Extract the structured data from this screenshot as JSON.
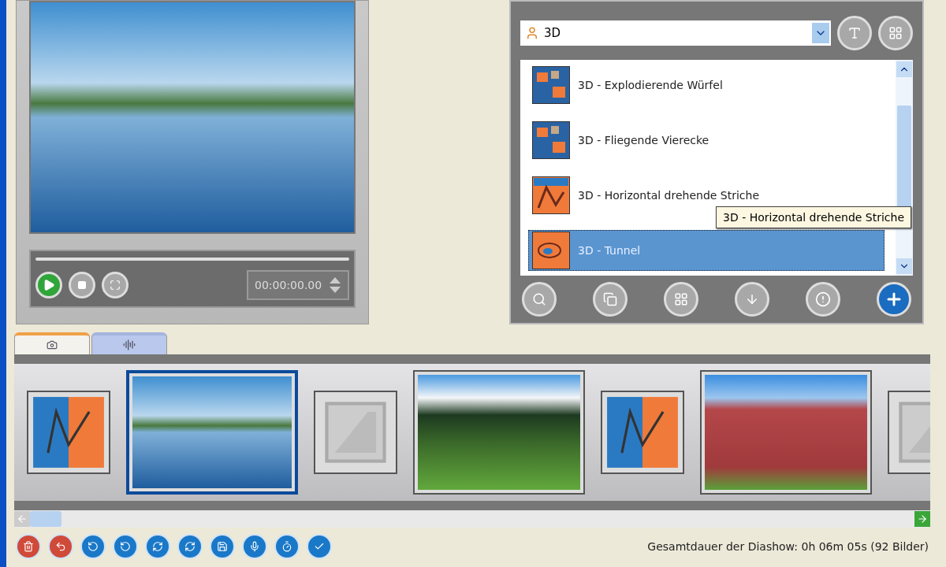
{
  "preview": {
    "time": "00:00:00.00"
  },
  "effects": {
    "category": "3D",
    "items": [
      {
        "label": "3D - Explodierende Würfel",
        "kind": "cubes",
        "selected": false
      },
      {
        "label": "3D - Fliegende Vierecke",
        "kind": "cubes",
        "selected": false
      },
      {
        "label": "3D - Horizontal drehende Striche",
        "kind": "stripes",
        "selected": false
      },
      {
        "label": "3D - Tunnel",
        "kind": "tunnel",
        "selected": true
      }
    ],
    "tooltip": "3D - Horizontal drehende Striche"
  },
  "tabs": [
    {
      "kind": "photos",
      "selected": true
    },
    {
      "kind": "audio",
      "selected": false
    }
  ],
  "filmstrip": [
    {
      "kind": "transition",
      "selected": false
    },
    {
      "kind": "photo",
      "selected": true
    },
    {
      "kind": "empty",
      "selected": false
    },
    {
      "kind": "photo",
      "selected": false
    },
    {
      "kind": "transition",
      "selected": false
    },
    {
      "kind": "photo",
      "selected": false
    },
    {
      "kind": "empty",
      "selected": false
    }
  ],
  "status": "Gesamtdauer der Diashow: 0h 06m 05s (92 Bilder)"
}
